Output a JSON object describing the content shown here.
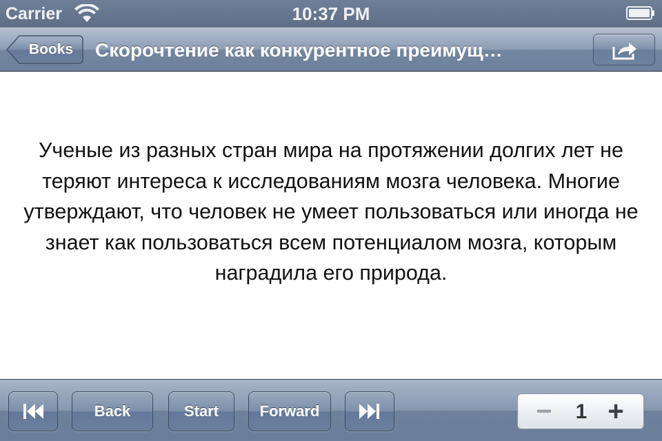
{
  "status_bar": {
    "carrier": "Carrier",
    "time": "10:37 PM",
    "icons": [
      "wifi-icon",
      "battery-icon"
    ]
  },
  "nav_bar": {
    "back_label": "Books",
    "title": "Скорочтение как конкурентное преимущ…",
    "share_icon": "share-icon"
  },
  "content": {
    "text": "Ученые из разных стран мира на протяжении долгих лет не теряют интереса к исследованиям мозга человека. Многие утверждают, что человек не умеет пользоваться или иногда не знает как пользоваться всем потенциалом мозга, которым наградила его природа."
  },
  "toolbar": {
    "first_icon": "skip-to-start-icon",
    "back_label": "Back",
    "start_label": "Start",
    "forward_label": "Forward",
    "last_icon": "skip-to-end-icon",
    "stepper": {
      "minus": "−",
      "value": "1",
      "plus": "+"
    }
  },
  "colors": {
    "bar_blue": "#7386a0",
    "text": "#111111",
    "background": "#ffffff"
  }
}
